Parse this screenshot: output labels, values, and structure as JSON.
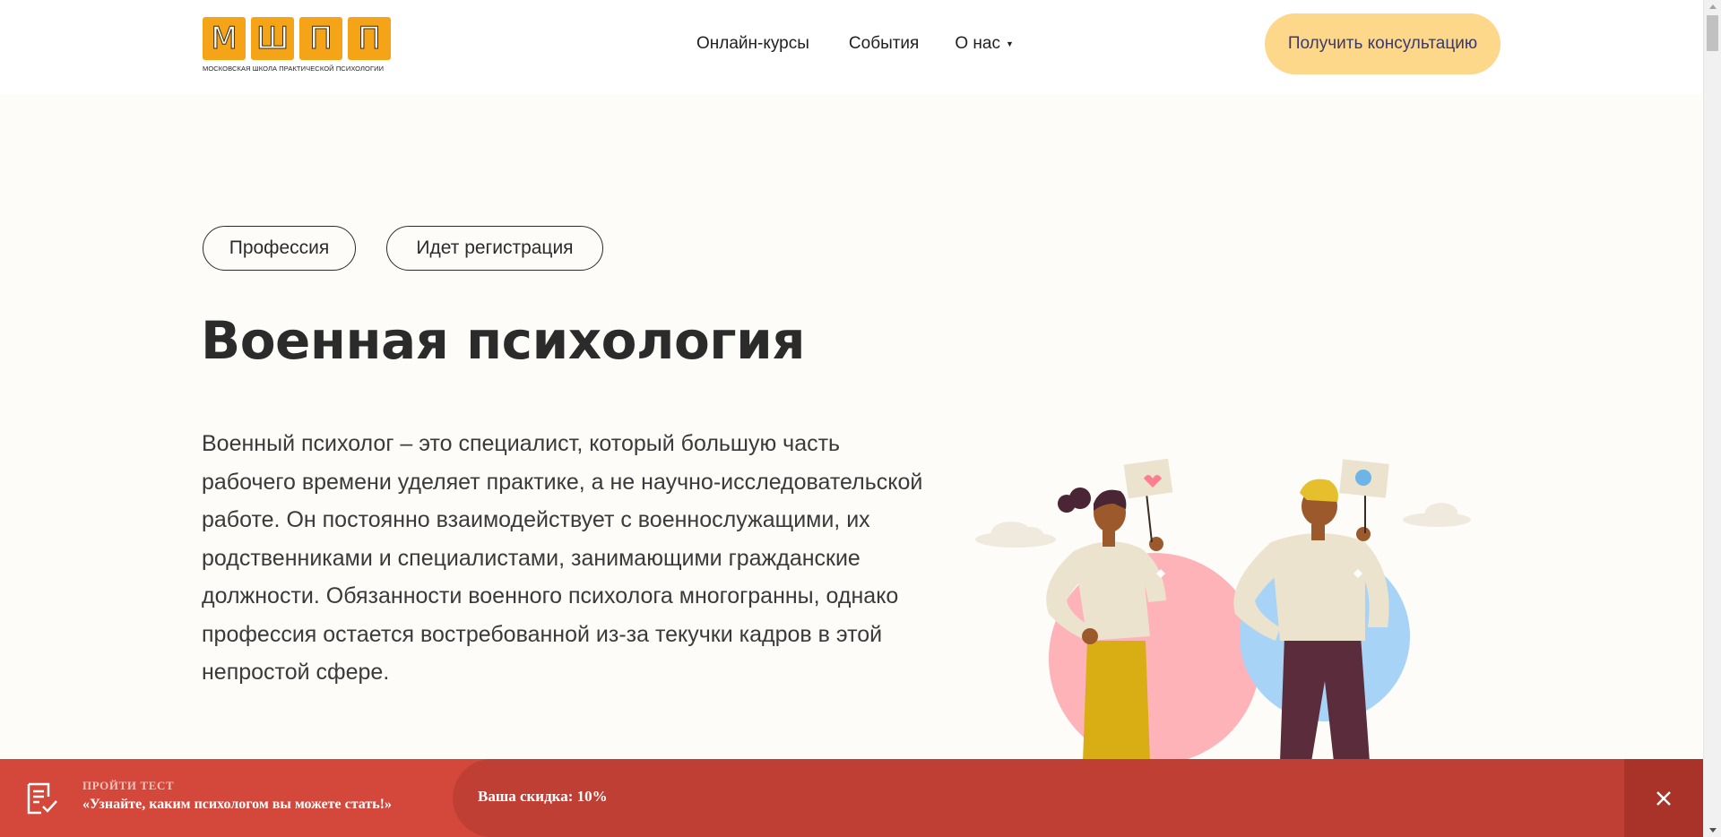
{
  "header": {
    "logo": {
      "letters": [
        "М",
        "Ш",
        "П",
        "П"
      ],
      "subtitle": "МОСКОВСКАЯ ШКОЛА ПРАКТИЧЕСКОЙ ПСИХОЛОГИИ",
      "tile_color": "#f4a416"
    },
    "nav": [
      {
        "label": "Онлайн-курсы"
      },
      {
        "label": "События"
      },
      {
        "label": "О нас",
        "icon": "caret-down-icon"
      }
    ],
    "cta_label": "Получить консультацию",
    "cta_color": "#fdd78a"
  },
  "hero": {
    "tags": [
      "Профессия",
      "Идет регистрация"
    ],
    "title": "Военная психология",
    "description": "Военный психолог – это специалист, который большую часть рабочего времени уделяет практике, а не научно-исследовательской работе. Он постоянно взаимодействует с военнослужащими, их родственниками и специалистами, занимающими гражданские должности. Обязанности военного психолога многогранны, однако профессия остается востребованной из-за текучки кадров в этой непростой сфере."
  },
  "banner": {
    "icon": "checklist-icon",
    "kicker": "ПРОЙТИ ТЕСТ",
    "text": "«Узнайте, каким психологом вы можете стать!»",
    "discount": "Ваша скидка: 10%",
    "close_icon": "close-icon",
    "color": "#d4483b"
  }
}
